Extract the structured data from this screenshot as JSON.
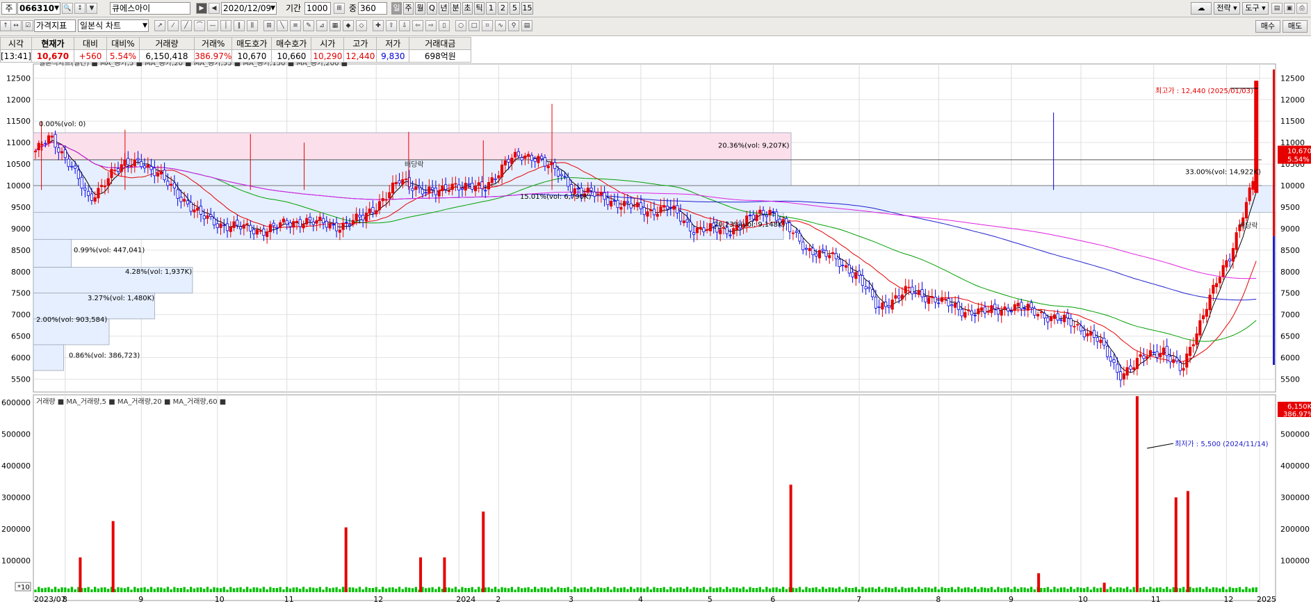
{
  "toolbar": {
    "market_label": "주",
    "code": "066310",
    "stock_name": "큐에스아이",
    "date": "2020/12/09",
    "period_label": "기간",
    "period_value": "1000",
    "zoom_label": "중",
    "zoom_value": "360",
    "timeframes": [
      "일",
      "주",
      "월",
      "Q",
      "년",
      "분",
      "초",
      "틱",
      "1",
      "2",
      "5",
      "15"
    ],
    "strategy_button": "전략",
    "tools_button": "도구",
    "indicator_select": "가격지표",
    "chart_type_select": "일본식 차트",
    "buy_button": "매수",
    "sell_button": "매도"
  },
  "quote": {
    "headers": [
      "시각",
      "현재가",
      "대비",
      "대비%",
      "거래량",
      "거래%",
      "매도호가",
      "매수호가",
      "시가",
      "고가",
      "저가",
      "거래대금"
    ],
    "values": [
      "[13:41]",
      "10,670",
      "+560",
      "5.54%",
      "6,150,418",
      "386.97%",
      "10,670",
      "10,660",
      "10,290",
      "12,440",
      "9,830",
      "698억원"
    ]
  },
  "chart_data": {
    "type": "candlestick",
    "legend": "일본식차트(일간) ■ MA_종가,5 ■ MA_종가,20 ■ MA_종가,55 ■ MA_종가,150 ■ MA_종가,200 ■",
    "vol_legend": "거래량 ■ MA_거래량,5 ■ MA_거래량,20 ■ MA_거래량,60 ■",
    "y_ticks": [
      5500,
      6000,
      6500,
      7000,
      7500,
      8000,
      8500,
      9000,
      9500,
      10000,
      10500,
      11000,
      11500,
      12000,
      12500
    ],
    "vol_ticks": [
      "100000",
      "200000",
      "300000",
      "400000",
      "500000",
      "600000"
    ],
    "vol_ticks_right": [
      "100000",
      "200000",
      "300000",
      "400000",
      "500000"
    ],
    "vol_axis_marker": "*10",
    "x_labels": [
      "2023/07",
      "8",
      "9",
      "10",
      "11",
      "12",
      "2024",
      "2",
      "3",
      "4",
      "5",
      "6",
      "7",
      "8",
      "9",
      "10",
      "11",
      "12",
      "2025"
    ],
    "price_levels": [
      {
        "label": "0.00%(vol: 0)",
        "width_fraction": 0.0
      },
      {
        "label": "20.36%(vol: 9,207K)",
        "width_fraction": 1.0
      },
      {
        "label": "33.00%(vol: 14,922K)",
        "width_fraction": 1.0
      },
      {
        "label": "15.01%(vol: 6,790K)",
        "width_fraction": 0.74
      },
      {
        "label": "20.23%(vol: 9,148K)",
        "width_fraction": 0.99
      },
      {
        "label": "0.99%(vol: 447,041)",
        "width_fraction": 0.05
      },
      {
        "label": "4.28%(vol: 1,937K)",
        "width_fraction": 0.21
      },
      {
        "label": "3.27%(vol: 1,480K)",
        "width_fraction": 0.16
      },
      {
        "label": "2.00%(vol: 903,584)",
        "width_fraction": 0.1
      },
      {
        "label": "0.86%(vol: 386,723)",
        "width_fraction": 0.04
      }
    ],
    "high_label": "최고가 : 12,440 (2025/01/03)",
    "low_label": "최저가 : 5,500 (2024/11/14)",
    "event_label": "배당락",
    "current_price": "10,670",
    "current_change": "5.54%",
    "current_volume": "6,150K",
    "current_volume_pct": "386.97%"
  }
}
